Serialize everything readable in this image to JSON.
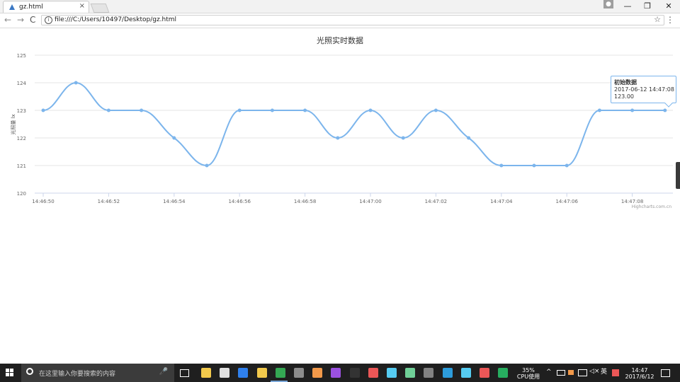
{
  "browser": {
    "tab_title": "gz.html",
    "tab_close": "×",
    "profile_icon": "person-icon",
    "win_minimize": "—",
    "win_maximize": "❐",
    "win_close": "✕",
    "back": "←",
    "forward": "→",
    "reload": "C",
    "url": "file:///C:/Users/10497/Desktop/gz.html",
    "star": "☆",
    "menu": "⋮"
  },
  "chart_data": {
    "type": "line",
    "title": "光照实时数据",
    "ylabel": "光照量 lx",
    "ylim": [
      120,
      125
    ],
    "yticks": [
      120,
      121,
      122,
      123,
      124,
      125
    ],
    "xtick_labels": [
      "14:46:50",
      "14:46:52",
      "14:46:54",
      "14:46:56",
      "14:46:58",
      "14:47:00",
      "14:47:02",
      "14:47:04",
      "14:47:06",
      "14:47:08"
    ],
    "x": [
      "14:46:50",
      "14:46:51",
      "14:46:52",
      "14:46:53",
      "14:46:54",
      "14:46:55",
      "14:46:56",
      "14:46:57",
      "14:46:58",
      "14:46:59",
      "14:47:00",
      "14:47:01",
      "14:47:02",
      "14:47:03",
      "14:47:04",
      "14:47:05",
      "14:47:06",
      "14:47:07",
      "14:47:08",
      "14:47:09"
    ],
    "series": [
      {
        "values": [
          123,
          124,
          123,
          123,
          122,
          121,
          123,
          123,
          123,
          122,
          123,
          122,
          123,
          122,
          121,
          121,
          121,
          123,
          123,
          123
        ],
        "color": "#7cb5ec"
      }
    ],
    "credits": "Highcharts.com.cn",
    "grid": true,
    "legend": "none"
  },
  "tooltip": {
    "series_name": "初始数据",
    "time": "2017-06-12 14:47:08",
    "value": "123.00"
  },
  "taskbar": {
    "search_placeholder": "在这里输入你要搜索的内容",
    "cpu_percent": "35%",
    "cpu_label": "CPU使用",
    "ime": "英",
    "time": "14:47",
    "date": "2017/6/12",
    "apps": [
      {
        "name": "file-explorer-icon",
        "color": "#f2c94c"
      },
      {
        "name": "store-icon",
        "color": "#e0e0e0"
      },
      {
        "name": "sogou-browser-icon",
        "color": "#2f80ed"
      },
      {
        "name": "qq-music-icon",
        "color": "#f2c94c"
      },
      {
        "name": "chrome-icon",
        "color": "#34a853"
      },
      {
        "name": "app-icon",
        "color": "#8c8c8c"
      },
      {
        "name": "firefox-icon",
        "color": "#f2994a"
      },
      {
        "name": "intellij-icon",
        "color": "#9b51e0"
      },
      {
        "name": "terminal-icon",
        "color": "#333333"
      },
      {
        "name": "xampp-icon",
        "color": "#eb5757"
      },
      {
        "name": "virtualbox-icon",
        "color": "#56ccf2"
      },
      {
        "name": "wechat-icon",
        "color": "#6fcf97"
      },
      {
        "name": "app-icon",
        "color": "#828282"
      },
      {
        "name": "buildings-icon",
        "color": "#2d9cdb"
      },
      {
        "name": "app-icon",
        "color": "#56ccf2"
      },
      {
        "name": "app-icon",
        "color": "#eb5757"
      },
      {
        "name": "app-icon",
        "color": "#27ae60"
      }
    ]
  }
}
